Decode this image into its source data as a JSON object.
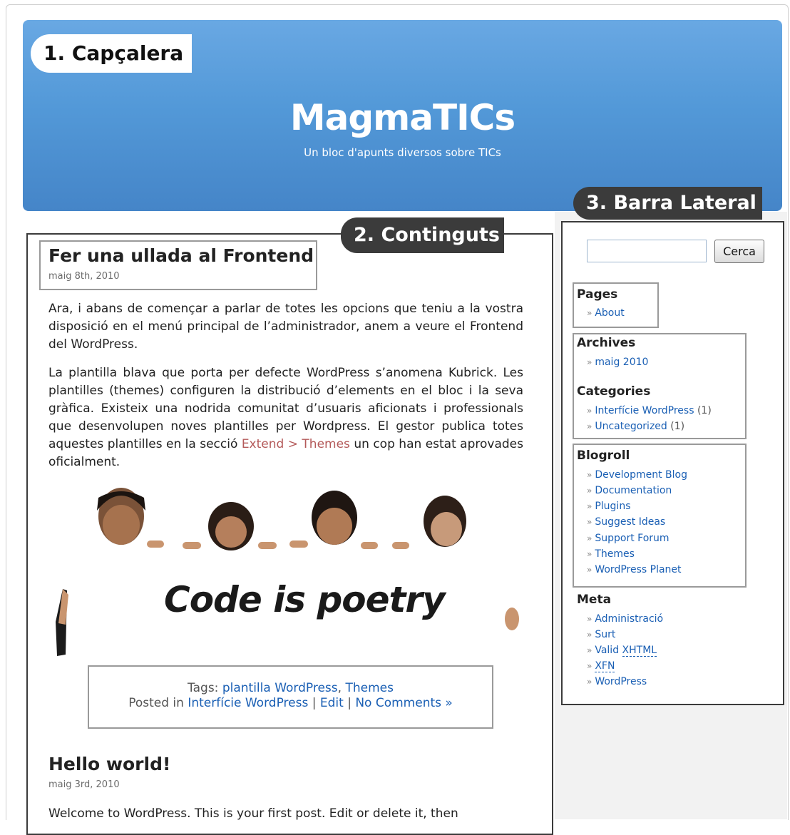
{
  "annotations": {
    "header": "1. Capçalera",
    "content": "2. Continguts",
    "sidebar": "3. Barra Lateral"
  },
  "blog": {
    "title": "MagmaTICs",
    "tagline": "Un bloc d'apunts diversos sobre TICs"
  },
  "post1": {
    "title": "Fer una ullada al Frontend",
    "date": "maig 8th, 2010",
    "p1": "Ara, i abans de començar a parlar de totes les opcions que teniu a la vostra disposició en el menú principal de l’administrador, anem a veure el Frontend del WordPress.",
    "p2_text": "La plantilla blava que porta per defecte WordPress s’anomena Kubrick. Les plantilles (themes) configuren la distribució d’elements en el bloc i la seva gràfica. Existeix una nodrida comunitat d’usuaris aficionats i professionals que desenvolupen noves plantilles per Wordpress. El gestor publica totes aquestes plantilles en la secció",
    "p2_link": "Extend > Themes",
    "p2_end": "un cop han estat aprovades oficialment.",
    "image_text": "Code is poetry",
    "tags_label": "Tags:",
    "tag1": "plantilla WordPress",
    "tag_sep": ",",
    "tag2": "Themes",
    "posted_in": "Posted in",
    "category": "Interfície WordPress",
    "sep": "|",
    "edit": "Edit",
    "comments": "No Comments »"
  },
  "post2": {
    "title": "Hello world!",
    "date": "maig 3rd, 2010",
    "p1": "Welcome to WordPress. This is your first post. Edit or delete it, then"
  },
  "sidebar": {
    "search_button": "Cerca",
    "search_value": "",
    "bullet": "»",
    "pages_title": "Pages",
    "pages": [
      {
        "label": "About"
      }
    ],
    "archives_title": "Archives",
    "archives": [
      {
        "label": "maig 2010"
      }
    ],
    "categories_title": "Categories",
    "categories": [
      {
        "label": "Interfície WordPress",
        "count": "(1)"
      },
      {
        "label": "Uncategorized",
        "count": "(1)"
      }
    ],
    "blogroll_title": "Blogroll",
    "blogroll": [
      {
        "label": "Development Blog"
      },
      {
        "label": "Documentation"
      },
      {
        "label": "Plugins"
      },
      {
        "label": "Suggest Ideas"
      },
      {
        "label": "Support Forum"
      },
      {
        "label": "Themes"
      },
      {
        "label": "WordPress Planet"
      }
    ],
    "meta_title": "Meta",
    "meta": [
      {
        "label": "Administració"
      },
      {
        "label": "Surt"
      },
      {
        "pre": "Valid ",
        "abbr": "XHTML"
      },
      {
        "abbr": "XFN"
      },
      {
        "label": "WordPress"
      }
    ]
  },
  "colors": {
    "header_blue": "#5399d8",
    "annotation_dark": "#3b3b3b",
    "link_blue": "#1a5fb4",
    "link_red": "#b45a5a"
  }
}
